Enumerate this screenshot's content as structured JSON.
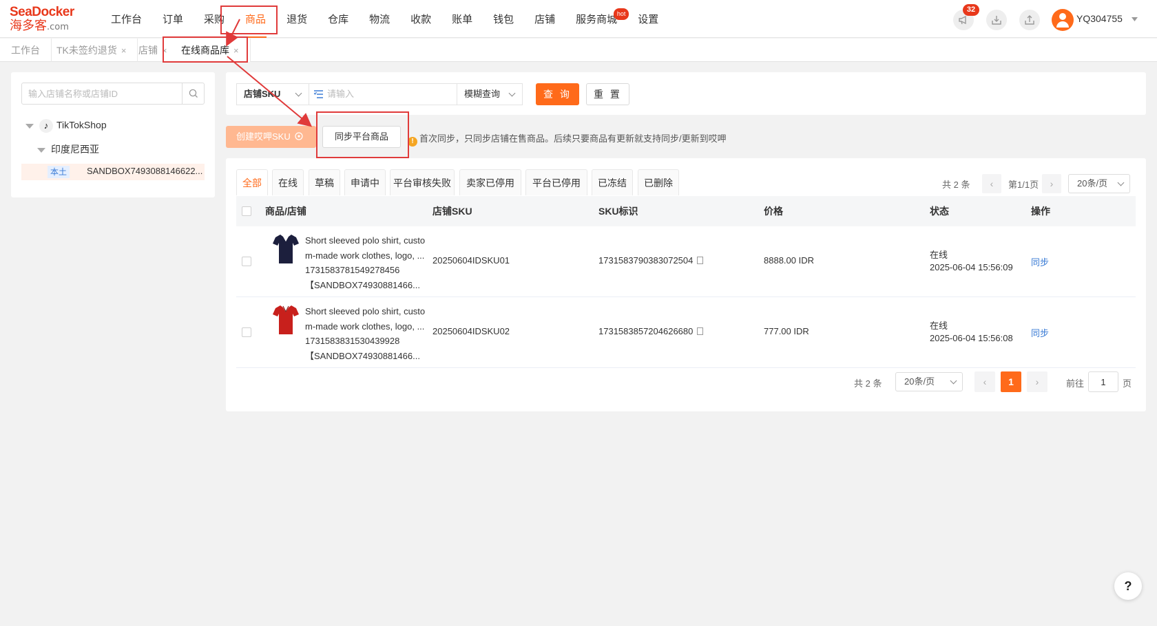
{
  "logo": {
    "line1": "SeaDocker",
    "line2": "海多客",
    "suffix": ".com"
  },
  "nav": {
    "items": [
      "工作台",
      "订单",
      "采购",
      "商品",
      "退货",
      "仓库",
      "物流",
      "收款",
      "账单",
      "钱包",
      "店铺",
      "服务商城",
      "设置"
    ],
    "active": "商品",
    "hot_badge": "hot"
  },
  "header_right": {
    "notification_count": "32",
    "username": "YQ304755"
  },
  "tabs": [
    {
      "label": "工作台",
      "closable": false
    },
    {
      "label": "TK未签约退货",
      "closable": true
    },
    {
      "label": "店铺",
      "closable": true
    },
    {
      "label": "在线商品库",
      "closable": true
    }
  ],
  "tab_close_glyph": "×",
  "sidebar": {
    "search_placeholder": "输入店铺名称或店铺ID",
    "platform": "TikTokShop",
    "region": "印度尼西亚",
    "shop_tag": "本土",
    "shop_name": "SANDBOX7493088146622..."
  },
  "filter": {
    "field_select": "店铺SKU",
    "input_placeholder": "请输入",
    "mode_select": "模糊查询",
    "query_label": "查 询",
    "reset_label": "重 置"
  },
  "actions": {
    "create_label": "创建哎呷SKU",
    "sync_label": "同步平台商品",
    "notice": "首次同步，只同步店铺在售商品。后续只要商品有更新就支持同步/更新到哎呷"
  },
  "status_tabs": [
    "全部",
    "在线",
    "草稿",
    "申请中",
    "平台审核失败",
    "卖家已停用",
    "平台已停用",
    "已冻结",
    "已删除"
  ],
  "active_status_tab": "全部",
  "pager_top": {
    "total": "共 2 条",
    "page": "第1/1页",
    "page_size": "20条/页"
  },
  "table": {
    "headers": [
      "商品/店铺",
      "店铺SKU",
      "SKU标识",
      "价格",
      "状态",
      "操作"
    ],
    "rows": [
      {
        "name_line1": "Short sleeved polo shirt, custo",
        "name_line2": "m-made work clothes, logo, ...",
        "product_id": "1731583781549278456",
        "shop": "【SANDBOX74930881466...",
        "shirt_color": "#1c1f3d",
        "shop_sku": "20250604IDSKU01",
        "sku_id": "1731583790383072504",
        "price": "8888.00 IDR",
        "status": "在线",
        "time": "2025-06-04 15:56:09",
        "action": "同步"
      },
      {
        "name_line1": "Short sleeved polo shirt, custo",
        "name_line2": "m-made work clothes, logo, ...",
        "product_id": "1731583831530439928",
        "shop": "【SANDBOX74930881466...",
        "shirt_color": "#c8201c",
        "shop_sku": "20250604IDSKU02",
        "sku_id": "1731583857204626680",
        "price": "777.00 IDR",
        "status": "在线",
        "time": "2025-06-04 15:56:08",
        "action": "同步"
      }
    ]
  },
  "pager_bottom": {
    "total": "共 2 条",
    "page_size": "20条/页",
    "current": "1",
    "goto_label": "前往",
    "goto_value": "1",
    "page_unit": "页"
  },
  "help": "?",
  "colors": {
    "accent": "#ff6a1a",
    "annotation": "#e03a3a",
    "link": "#3a7bd5"
  }
}
